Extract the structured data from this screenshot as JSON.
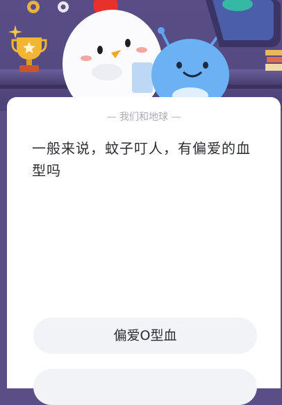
{
  "header": {
    "scene": "quiz illustration with chicken mascot and blue alien on a shelf",
    "icons": [
      "gear-icon",
      "trophy-icon",
      "sparkle-icon",
      "globe-icon",
      "books-icon"
    ]
  },
  "quiz": {
    "subtitle": "— 我们和地球 —",
    "question": "一般来说，蚊子叮人，有偏爱的血型吗",
    "options": [
      "偏爱O型血",
      ""
    ]
  },
  "colors": {
    "header_bg": "#5a4d86",
    "card_bg": "#ffffff",
    "option_bg": "#f1f3f6",
    "text": "#2a2d33",
    "subtitle": "#a9adb5"
  }
}
